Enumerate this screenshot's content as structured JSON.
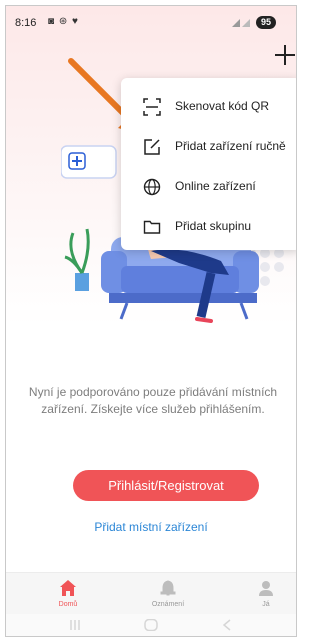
{
  "status_bar": {
    "time": "8:16",
    "notif_icons": "◙ ⊛ ♥",
    "battery": "95"
  },
  "header": {
    "add_icon": "plus-icon"
  },
  "menu": {
    "items": [
      {
        "label": "Skenovat kód QR",
        "icon": "qr-scan-icon"
      },
      {
        "label": "Přidat zařízení ručně",
        "icon": "edit-icon"
      },
      {
        "label": "Online zařízení",
        "icon": "globe-icon"
      },
      {
        "label": "Přidat skupinu",
        "icon": "folder-icon"
      }
    ]
  },
  "main": {
    "message": "Nyní je podporováno pouze přidávání místních zařízení. Získejte více služeb přihlášením.",
    "login_label": "Přihlásit/Registrovat",
    "add_local_label": "Přidat místní zařízení"
  },
  "bottom_nav": {
    "items": [
      {
        "label": "Domů",
        "icon": "home-icon",
        "active": true
      },
      {
        "label": "Oznámení",
        "icon": "bell-icon",
        "active": false
      },
      {
        "label": "Já",
        "icon": "person-icon",
        "active": false
      }
    ]
  },
  "colors": {
    "accent": "#f05457",
    "link": "#2b86d6",
    "arrow": "#e87722"
  }
}
